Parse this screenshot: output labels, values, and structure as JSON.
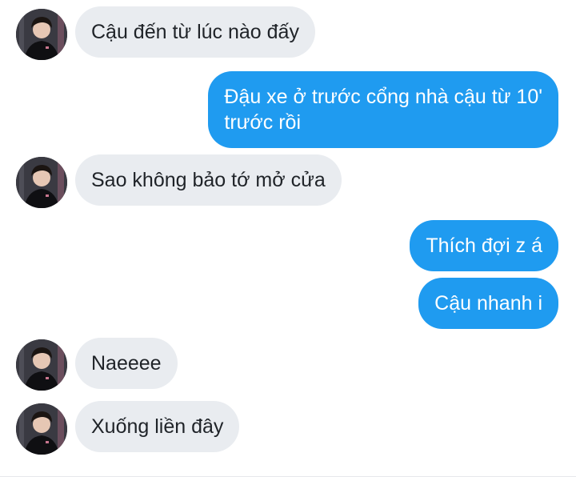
{
  "messages": [
    {
      "from": "them",
      "text": "Cậu đến từ lúc nào đấy"
    },
    {
      "from": "me",
      "lines": [
        "Đậu xe ở trước cổng nhà cậu từ 10'",
        "trước rồi"
      ]
    },
    {
      "from": "them",
      "text": "Sao không bảo tớ mở cửa"
    },
    {
      "from": "me",
      "text": "Thích đợi z á"
    },
    {
      "from": "me",
      "text": "Cậu nhanh i"
    },
    {
      "from": "them",
      "text": "Naeeee"
    },
    {
      "from": "them",
      "text": "Xuống liền đây"
    }
  ],
  "colors": {
    "incoming_bubble": "#e9ecf0",
    "outgoing_bubble": "#1f9bf0",
    "incoming_text": "#1f2328",
    "outgoing_text": "#ffffff"
  },
  "icons": {
    "avatar": "contact-avatar-photo"
  }
}
